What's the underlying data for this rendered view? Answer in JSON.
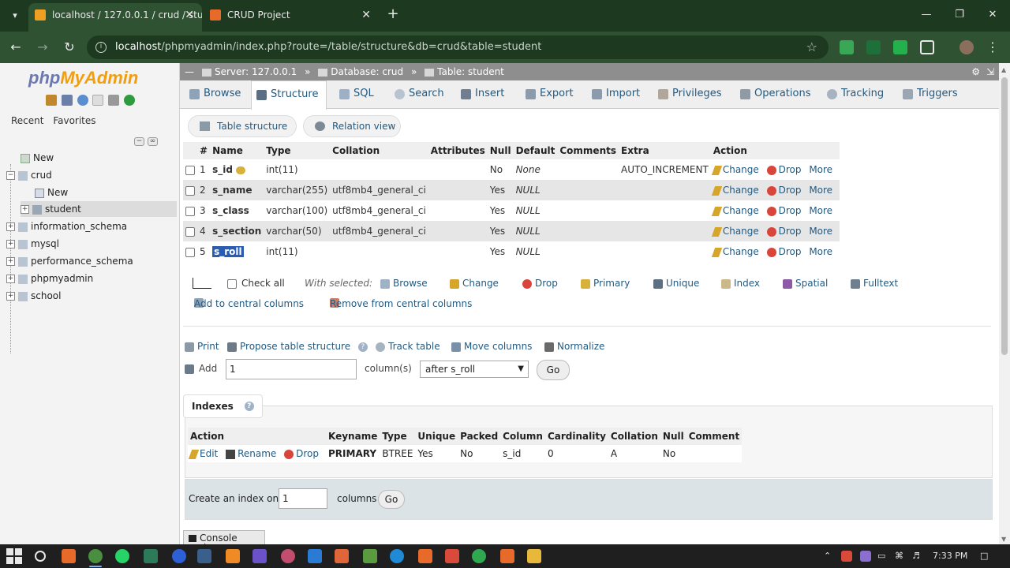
{
  "browser": {
    "tabs": [
      {
        "title": "localhost / 127.0.0.1 / crud / stu",
        "active": true
      },
      {
        "title": "CRUD Project",
        "active": false
      }
    ],
    "url_host": "localhost",
    "url_path": "/phpmyadmin/index.php?route=/table/structure&db=crud&table=student"
  },
  "nav": {
    "logo_php": "php",
    "logo_myadmin": "MyAdmin",
    "recent": "Recent",
    "favorites": "Favorites",
    "tree": [
      {
        "label": "New"
      },
      {
        "label": "crud"
      },
      {
        "label": "New"
      },
      {
        "label": "student"
      },
      {
        "label": "information_schema"
      },
      {
        "label": "mysql"
      },
      {
        "label": "performance_schema"
      },
      {
        "label": "phpmyadmin"
      },
      {
        "label": "school"
      }
    ]
  },
  "breadcrumb": {
    "server": "Server: 127.0.0.1",
    "database": "Database: crud",
    "table": "Table: student"
  },
  "menu": [
    "Browse",
    "Structure",
    "SQL",
    "Search",
    "Insert",
    "Export",
    "Import",
    "Privileges",
    "Operations",
    "Tracking",
    "Triggers"
  ],
  "subtabs": [
    "Table structure",
    "Relation view"
  ],
  "structure": {
    "headers": [
      "#",
      "Name",
      "Type",
      "Collation",
      "Attributes",
      "Null",
      "Default",
      "Comments",
      "Extra",
      "Action"
    ],
    "rows": [
      {
        "num": "1",
        "name": "s_id",
        "type": "int(11)",
        "collation": "",
        "attributes": "",
        "null": "No",
        "default": "None",
        "comments": "",
        "extra": "AUTO_INCREMENT"
      },
      {
        "num": "2",
        "name": "s_name",
        "type": "varchar(255)",
        "collation": "utf8mb4_general_ci",
        "attributes": "",
        "null": "Yes",
        "default": "NULL",
        "comments": "",
        "extra": ""
      },
      {
        "num": "3",
        "name": "s_class",
        "type": "varchar(100)",
        "collation": "utf8mb4_general_ci",
        "attributes": "",
        "null": "Yes",
        "default": "NULL",
        "comments": "",
        "extra": ""
      },
      {
        "num": "4",
        "name": "s_section",
        "type": "varchar(50)",
        "collation": "utf8mb4_general_ci",
        "attributes": "",
        "null": "Yes",
        "default": "NULL",
        "comments": "",
        "extra": ""
      },
      {
        "num": "5",
        "name": "s_roll",
        "type": "int(11)",
        "collation": "",
        "attributes": "",
        "null": "Yes",
        "default": "NULL",
        "comments": "",
        "extra": ""
      }
    ],
    "actions": {
      "change": "Change",
      "drop": "Drop",
      "more": "More"
    }
  },
  "bulk": {
    "check_all": "Check all",
    "with_selected": "With selected:",
    "items": [
      "Browse",
      "Change",
      "Drop",
      "Primary",
      "Unique",
      "Index",
      "Spatial",
      "Fulltext"
    ],
    "add_central": "Add to central columns",
    "remove_central": "Remove from central columns"
  },
  "tools": {
    "print": "Print",
    "propose": "Propose table structure",
    "track": "Track table",
    "move": "Move columns",
    "normalize": "Normalize"
  },
  "add_columns": {
    "label": "Add",
    "value": "1",
    "unit": "column(s)",
    "position": "after s_roll",
    "go": "Go"
  },
  "indexes": {
    "title": "Indexes",
    "headers": [
      "Action",
      "Keyname",
      "Type",
      "Unique",
      "Packed",
      "Column",
      "Cardinality",
      "Collation",
      "Null",
      "Comment"
    ],
    "row": {
      "edit": "Edit",
      "rename": "Rename",
      "drop": "Drop",
      "keyname": "PRIMARY",
      "type": "BTREE",
      "unique": "Yes",
      "packed": "No",
      "column": "s_id",
      "cardinality": "0",
      "collation": "A",
      "null": "No",
      "comment": ""
    },
    "create_label": "Create an index on",
    "create_value": "1",
    "create_unit": "columns",
    "go": "Go"
  },
  "console": "Console",
  "taskbar": {
    "time": "7:33 PM"
  }
}
